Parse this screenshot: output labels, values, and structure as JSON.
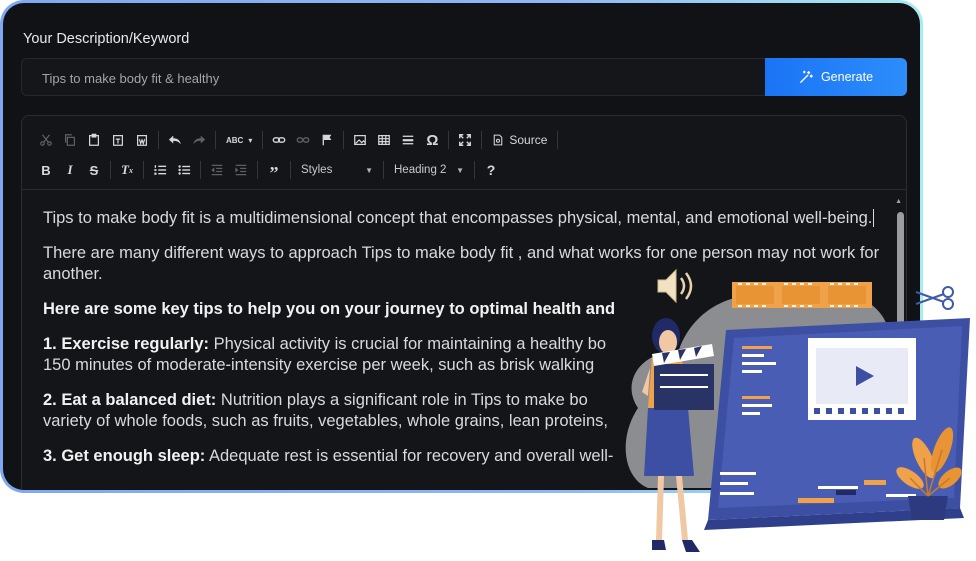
{
  "form": {
    "label": "Your Description/Keyword",
    "input_value": "Tips to make body fit & healthy",
    "generate_label": "Generate"
  },
  "toolbar": {
    "source_label": "Source",
    "styles_label": "Styles",
    "format_label": "Heading 2",
    "help_label": "?",
    "spell_label": "ABC"
  },
  "content": {
    "p1": "Tips to make body fit is a multidimensional concept that encompasses physical, mental, and emotional well-being.",
    "p2": "There are many different ways to approach Tips to make body fit , and what works for one person may not work for another.",
    "p3": "Here are some key tips to help you on your journey to optimal health and",
    "p4_bold": "1. Exercise regularly:",
    "p4_text": " Physical activity is crucial for maintaining a healthy bo",
    "p4_line2": "150 minutes of moderate-intensity exercise per week, such as brisk walking",
    "p5_bold": "2. Eat a balanced diet:",
    "p5_text": " Nutrition plays a significant role in Tips to make bo",
    "p5_line2": "variety of whole foods, such as fruits, vegetables, whole grains, lean proteins,",
    "p6_bold": "3. Get enough sleep:",
    "p6_text": " Adequate rest is essential for recovery and overall well-"
  },
  "colors": {
    "accent": "#1a74f5",
    "card_border_start": "#7fa8f0",
    "card_border_end": "#a8ecf2",
    "background": "#111216"
  }
}
